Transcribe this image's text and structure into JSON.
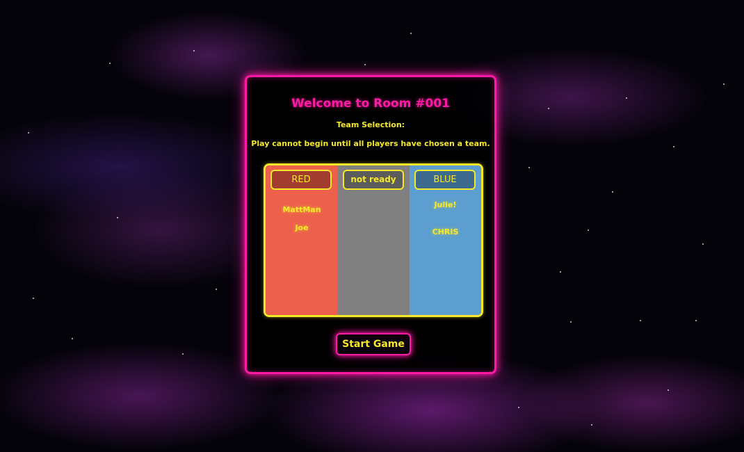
{
  "room": {
    "title": "Welcome to Room #001",
    "subtitle": "Team Selection:",
    "note": "Play cannot begin until all players have chosen a team."
  },
  "teams": {
    "red": {
      "label": "RED",
      "players": [
        "MattMan",
        "Joe"
      ]
    },
    "unassigned": {
      "label": "not ready",
      "players": []
    },
    "blue": {
      "label": "BLUE",
      "players": [
        "Julie!",
        "CHRIS"
      ]
    }
  },
  "actions": {
    "start_label": "Start Game"
  },
  "colors": {
    "accent": "#ff1aa6",
    "highlight": "#f5e92a",
    "red_team": "#ec604c",
    "unassigned": "#808080",
    "blue_team": "#5b9ecf"
  }
}
